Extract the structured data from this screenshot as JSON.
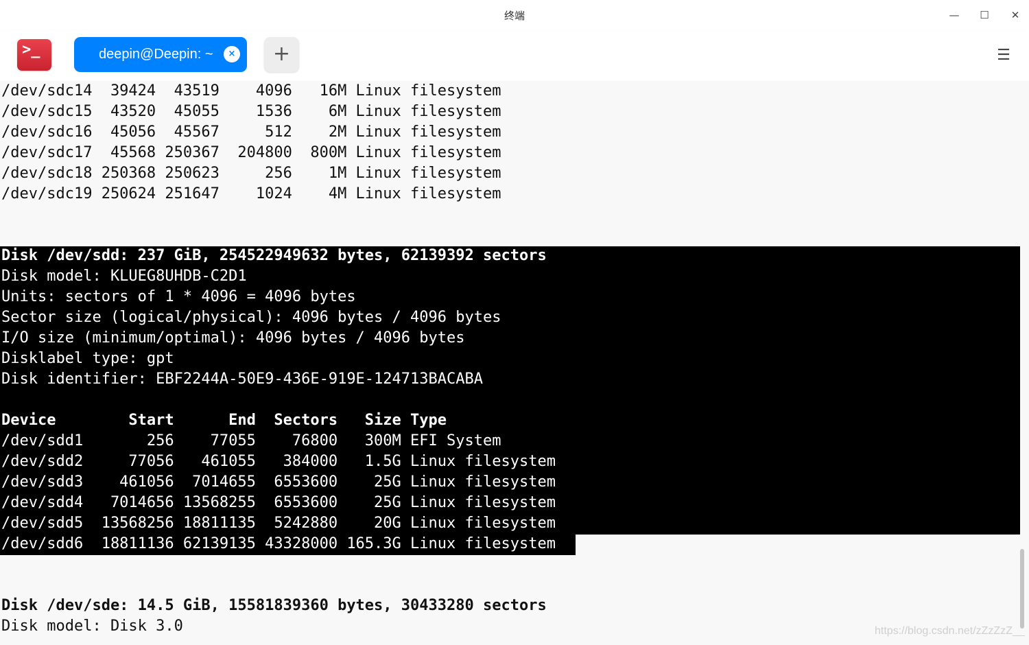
{
  "window": {
    "title": "终端",
    "minimize_glyph": "—",
    "maximize_glyph": "☐",
    "close_glyph": "✕"
  },
  "tabbar": {
    "app_icon_glyph": ">_",
    "tabs": [
      {
        "label": "deepin@Deepin: ~",
        "close_glyph": "×"
      }
    ],
    "add_glyph": "+",
    "menu_glyph": "☰"
  },
  "terminal": {
    "lines": [
      "/dev/sdc14  39424  43519    4096   16M Linux filesystem",
      "/dev/sdc15  43520  45055    1536    6M Linux filesystem",
      "/dev/sdc16  45056  45567     512    2M Linux filesystem",
      "/dev/sdc17  45568 250367  204800  800M Linux filesystem",
      "/dev/sdc18 250368 250623     256    1M Linux filesystem",
      "/dev/sdc19 250624 251647    1024    4M Linux filesystem",
      "",
      "",
      "Disk /dev/sdd: 237 GiB, 254522949632 bytes, 62139392 sectors",
      "Disk model: KLUEG8UHDB-C2D1",
      "Units: sectors of 1 * 4096 = 4096 bytes",
      "Sector size (logical/physical): 4096 bytes / 4096 bytes",
      "I/O size (minimum/optimal): 4096 bytes / 4096 bytes",
      "Disklabel type: gpt",
      "Disk identifier: EBF2244A-50E9-436E-919E-124713BACABA",
      "",
      "Device        Start      End  Sectors   Size Type",
      "/dev/sdd1       256    77055    76800   300M EFI System",
      "/dev/sdd2     77056   461055   384000   1.5G Linux filesystem",
      "/dev/sdd3    461056  7014655  6553600    25G Linux filesystem",
      "/dev/sdd4   7014656 13568255  6553600    25G Linux filesystem",
      "/dev/sdd5  13568256 18811135  5242880    20G Linux filesystem",
      "/dev/sdd6  18811136 62139135 43328000 165.3G Linux filesystem",
      "",
      "",
      "Disk /dev/sde: 14.5 GiB, 15581839360 bytes, 30433280 sectors",
      "Disk model: Disk 3.0"
    ],
    "watermark": "https://blog.csdn.net/zZzZzZ__"
  },
  "colors": {
    "tab_active": "#0081ff",
    "app_icon": "#d92f3b",
    "selection_bg": "#000000",
    "terminal_bg": "#f8f8f8"
  }
}
